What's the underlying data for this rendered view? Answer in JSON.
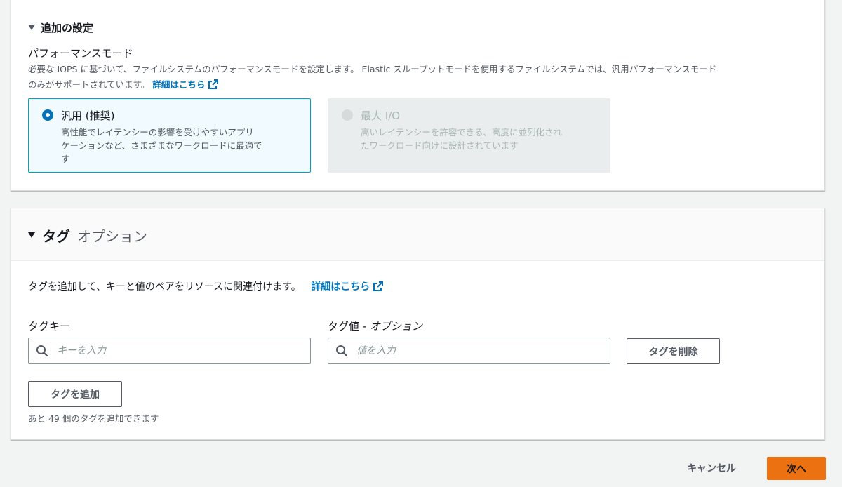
{
  "additional_settings": {
    "title": "追加の設定",
    "performance_mode": {
      "label": "パフォーマンスモード",
      "description_line1": "必要な IOPS に基づいて、ファイルシステムのパフォーマンスモードを設定します。 Elastic スループットモードを使用するファイルシステムでは、汎用パフォーマンスモード",
      "description_line2": "のみがサポートされています。",
      "learn_more": "詳細はこちら",
      "options": [
        {
          "title": "汎用 (推奨)",
          "desc_line1": "高性能でレイテンシーの影響を受けやすいアプリ",
          "desc_line2": "ケーションなど、さまざまなワークロードに最適で",
          "desc_line3": "す",
          "selected": true
        },
        {
          "title": "最大 I/O",
          "desc_line1": "高いレイテンシーを許容できる、高度に並列化され",
          "desc_line2": "たワークロード向けに設計されています",
          "disabled": true
        }
      ]
    }
  },
  "tags": {
    "title": "タグ",
    "optional": "オプション",
    "description": "タグを追加して、キーと値のペアをリソースに関連付けます。",
    "learn_more": "詳細はこちら",
    "key_label": "タグキー",
    "value_label_main": "タグ値 - ",
    "value_label_opt": "オプション",
    "key_placeholder": "キーを入力",
    "value_placeholder": "値を入力",
    "remove_button": "タグを削除",
    "add_button": "タグを追加",
    "remaining": "あと 49 個のタグを追加できます"
  },
  "footer": {
    "cancel": "キャンセル",
    "next": "次へ"
  },
  "colors": {
    "link": "#0073bb",
    "primary_button": "#ec7211",
    "selected_border": "#00a1c9"
  }
}
